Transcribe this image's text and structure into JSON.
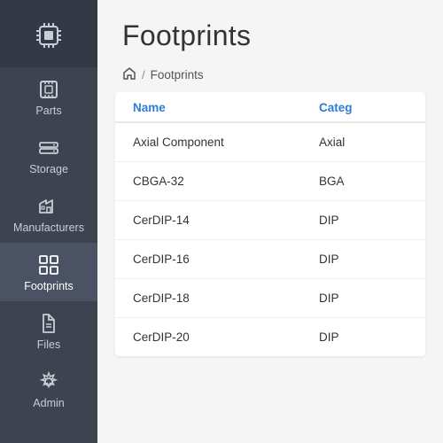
{
  "sidebar": {
    "items": [
      {
        "label": "Parts",
        "icon": "parts-icon"
      },
      {
        "label": "Storage",
        "icon": "storage-icon"
      },
      {
        "label": "Manufacturers",
        "icon": "manufacturers-icon"
      },
      {
        "label": "Footprints",
        "icon": "footprints-icon",
        "active": true
      },
      {
        "label": "Files",
        "icon": "files-icon"
      },
      {
        "label": "Admin",
        "icon": "admin-icon"
      }
    ]
  },
  "header": {
    "title": "Footprints"
  },
  "breadcrumb": {
    "sep": "/",
    "current": "Footprints"
  },
  "table": {
    "columns": [
      {
        "label": "Name"
      },
      {
        "label": "Categ"
      }
    ],
    "rows": [
      {
        "name": "Axial Component",
        "category": "Axial"
      },
      {
        "name": "CBGA-32",
        "category": "BGA"
      },
      {
        "name": "CerDIP-14",
        "category": "DIP"
      },
      {
        "name": "CerDIP-16",
        "category": "DIP"
      },
      {
        "name": "CerDIP-18",
        "category": "DIP"
      },
      {
        "name": "CerDIP-20",
        "category": "DIP"
      }
    ]
  }
}
